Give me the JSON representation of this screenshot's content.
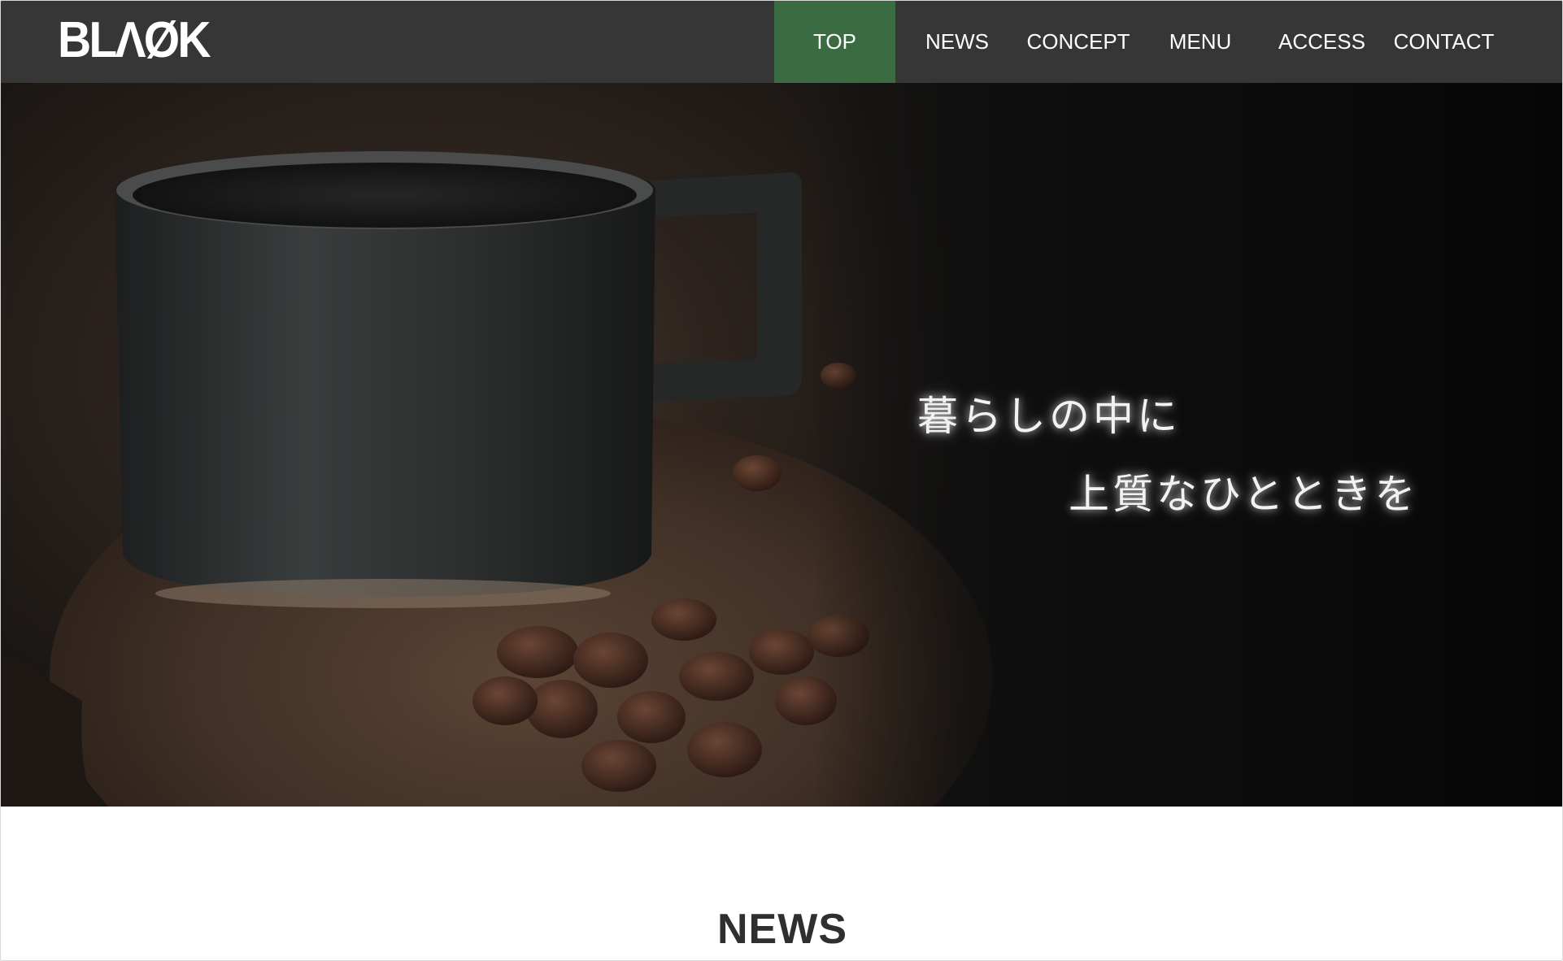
{
  "header": {
    "logo": "BLΛØK",
    "nav": [
      {
        "label": "TOP",
        "active": true
      },
      {
        "label": "NEWS",
        "active": false
      },
      {
        "label": "CONCEPT",
        "active": false
      },
      {
        "label": "MENU",
        "active": false
      },
      {
        "label": "ACCESS",
        "active": false
      },
      {
        "label": "CONTACT",
        "active": false
      }
    ]
  },
  "hero": {
    "image": "coffee-cup-and-beans-photo",
    "tagline_line1": "暮らしの中に",
    "tagline_line2": "上質なひとときを"
  },
  "news": {
    "title": "NEWS"
  },
  "colors": {
    "header_bg": "#363636",
    "active_nav_bg": "#3b6b41",
    "hero_dark": "#0b0b0b",
    "title_text": "#2f2f2f"
  }
}
